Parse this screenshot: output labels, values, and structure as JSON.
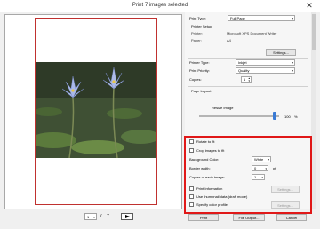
{
  "window": {
    "title": "Print  7 images selected",
    "close_glyph": "✕"
  },
  "preview": {
    "current_page": "1",
    "separator": "/",
    "total_pages": "7"
  },
  "settings": {
    "print_type_label": "Print Type:",
    "print_type_value": "Full Page",
    "printer_setup_heading": "Printer Setup",
    "printer_label": "Printer:",
    "printer_value": "Microsoft XPS Document Writer",
    "paper_label": "Paper:",
    "paper_value": "A4",
    "settings_button": "Settings...",
    "printer_type_label": "Printer Type:",
    "printer_type_value": "Inkjet",
    "print_priority_label": "Print Priority:",
    "print_priority_value": "Quality",
    "copies_label": "Copies:",
    "copies_value": "1",
    "page_layout_heading": "Page Layout",
    "resize_label": "Resize Image",
    "resize_value": "100",
    "resize_unit": "%"
  },
  "options": {
    "rotate_to_fit": "Rotate to fit",
    "crop_to_fit": "Crop images to fit",
    "background_color_label": "Background Color:",
    "background_color_value": "White",
    "border_width_label": "Border width:",
    "border_width_value": "0",
    "border_width_unit": "pt",
    "copies_each_label": "Copies of each image:",
    "copies_each_value": "1",
    "print_information": "Print Information",
    "print_info_settings": "Settings...",
    "use_thumbnail": "Use thumbnail data (draft mode)",
    "specify_color_profile": "Specify color profile",
    "color_profile_settings": "Settings..."
  },
  "footer": {
    "print": "Print",
    "file_output": "File Output...",
    "cancel": "Cancel"
  },
  "colors": {
    "highlight": "#e01818",
    "page_border": "#c0312f"
  },
  "icons": {
    "close": "close-icon",
    "next": "play-next-icon",
    "dropdown": "chevron-down-icon",
    "spinner": "spinner-arrows-icon"
  }
}
